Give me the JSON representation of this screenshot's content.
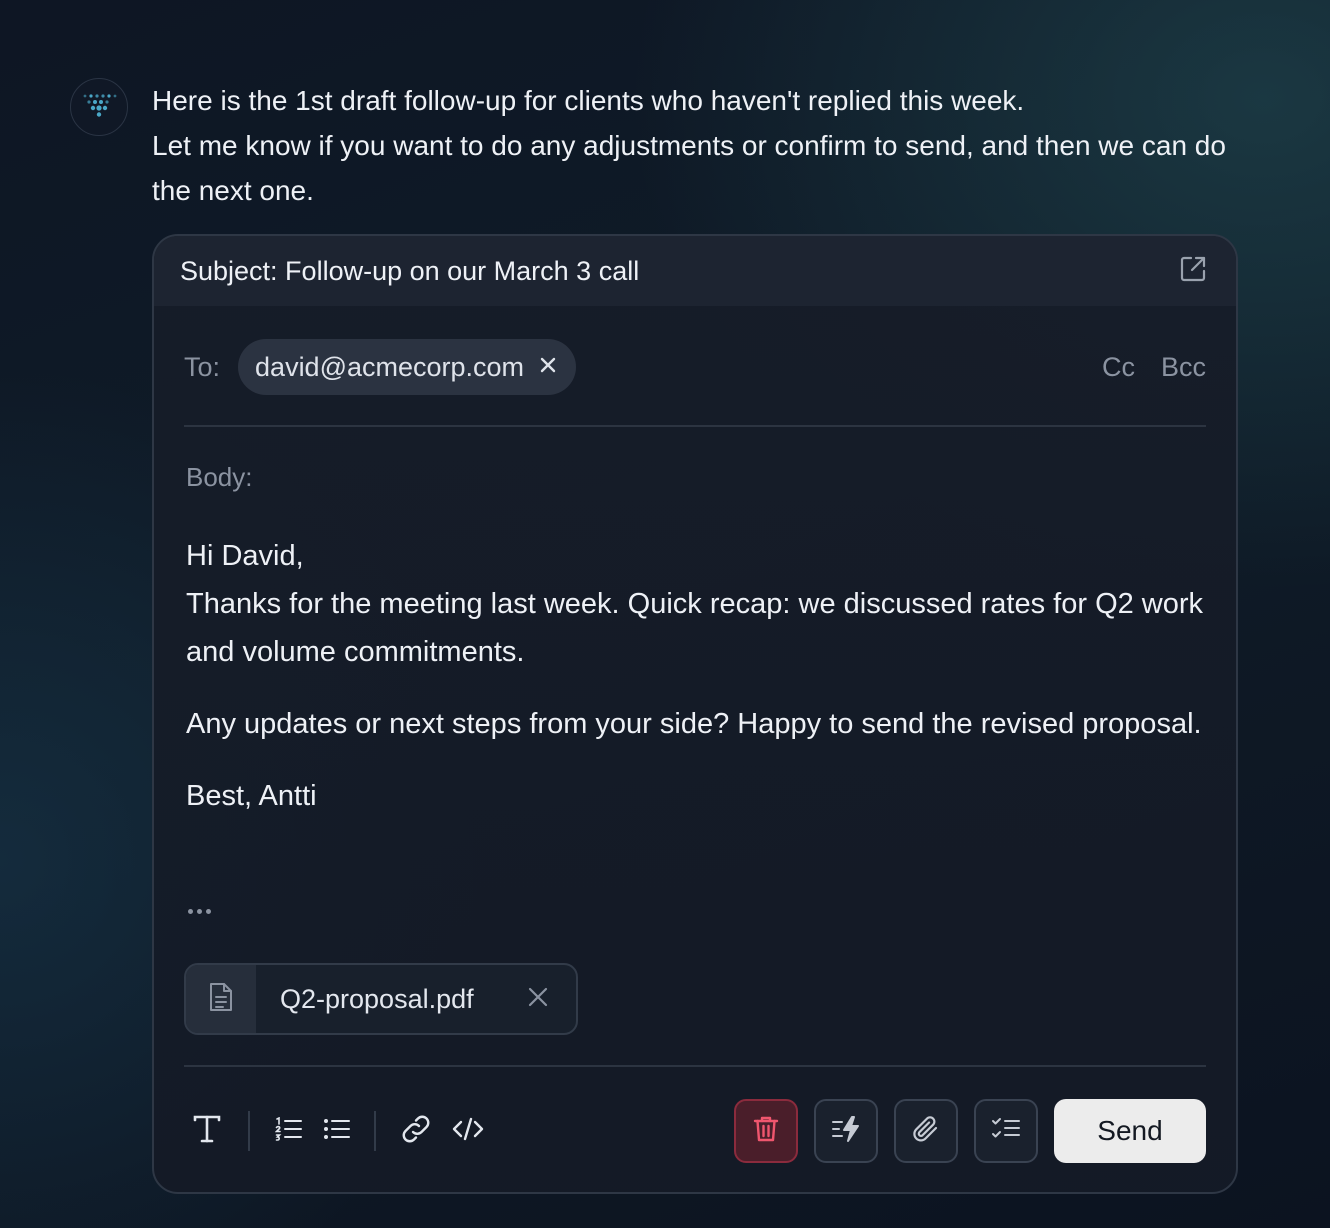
{
  "assistant": {
    "avatar_icon": "assistant-logo-icon",
    "message_lines": [
      "Here is the 1st draft follow-up for clients who haven't replied this week.",
      "Let me know if you want to do any adjustments or confirm to send, and then we can do the next one."
    ]
  },
  "email": {
    "subject": "Subject: Follow-up on our March 3 call",
    "to_label": "To:",
    "recipient": "david@acmecorp.com",
    "cc_label": "Cc",
    "bcc_label": "Bcc",
    "body_label": "Body:",
    "body": {
      "greeting": "Hi David,",
      "paragraph1": "Thanks for the meeting last week. Quick recap: we discussed rates for Q2 work and volume commitments.",
      "paragraph2": "Any updates or next steps from your side? Happy to send the revised proposal.",
      "signoff": "Best, Antti"
    },
    "attachment": {
      "name": "Q2-proposal.pdf",
      "icon": "file-icon"
    }
  },
  "toolbar": {
    "left_tools": [
      "text-format-icon",
      "numbered-list-icon",
      "bullet-list-icon",
      "link-icon",
      "code-icon"
    ],
    "right_tools": [
      "trash-icon",
      "quick-action-icon",
      "paperclip-icon",
      "checklist-icon"
    ],
    "send_label": "Send"
  },
  "colors": {
    "danger_bg": "#4a1e2a",
    "danger_icon": "#f0566e",
    "send_bg": "#ececec",
    "card_border": "#2e3745",
    "logo_accent": "#4aa8c8"
  }
}
